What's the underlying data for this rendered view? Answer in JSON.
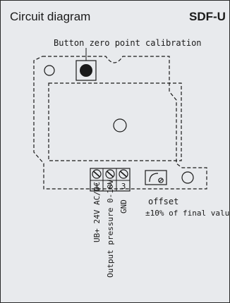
{
  "header": {
    "title": "Circuit diagram",
    "model": "SDF-U"
  },
  "labels": {
    "button_caption": "Button zero point calibration",
    "offset": "offset",
    "offset_range": "±10% of final value"
  },
  "terminals": [
    {
      "number": "1",
      "label": "UB+ 24V AC/DC"
    },
    {
      "number": "2",
      "label": "Output pressure 0-10V"
    },
    {
      "number": "3",
      "label": "GND"
    }
  ],
  "colors": {
    "background": "#e8eaed",
    "line": "#1a1a1a"
  }
}
